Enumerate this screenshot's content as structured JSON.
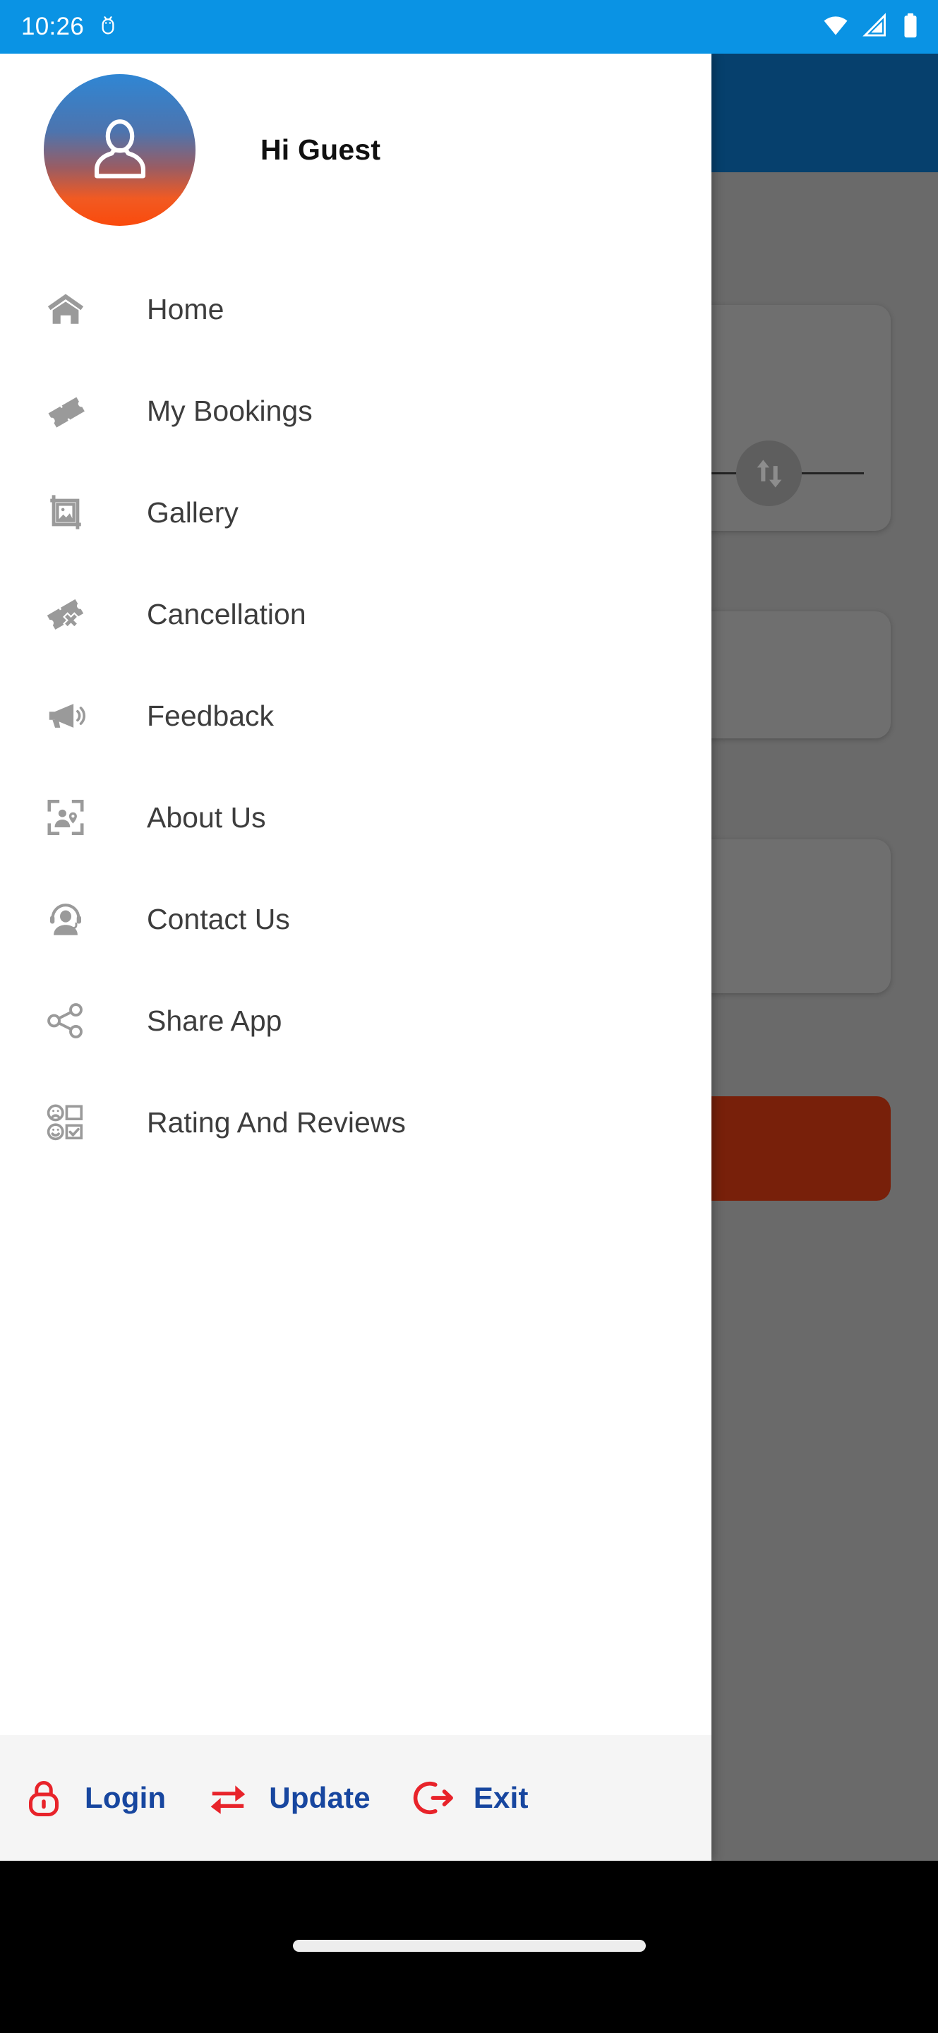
{
  "status_bar": {
    "time": "10:26",
    "icons": [
      "android-debug-icon",
      "wifi-icon",
      "cellular-signal-icon",
      "battery-icon"
    ],
    "background_color": "#0a93e4"
  },
  "background_app": {
    "appbar_color": "#06406d",
    "scrim_color": "#6a6a6a",
    "swap_button_icon": "swap-vertical-icon",
    "primary_button_color": "#78200a",
    "cards": [
      "search-card",
      "offer-card",
      "info-card"
    ]
  },
  "drawer": {
    "header": {
      "avatar_icon": "user-avatar-icon",
      "greeting": "Hi Guest",
      "avatar_gradient_from": "#2f86d4",
      "avatar_gradient_to": "#fa4a0c"
    },
    "items": [
      {
        "label": "Home",
        "icon": "home-icon"
      },
      {
        "label": "My Bookings",
        "icon": "ticket-icon"
      },
      {
        "label": "Gallery",
        "icon": "image-crop-icon"
      },
      {
        "label": "Cancellation",
        "icon": "ticket-cancel-icon"
      },
      {
        "label": "Feedback",
        "icon": "megaphone-icon"
      },
      {
        "label": "About Us",
        "icon": "person-location-frame-icon"
      },
      {
        "label": "Contact Us",
        "icon": "headset-support-icon"
      },
      {
        "label": "Share App",
        "icon": "share-nodes-icon"
      },
      {
        "label": "Rating And Reviews",
        "icon": "survey-emoji-icon"
      }
    ],
    "item_text_color": "#3d3d3d",
    "icon_color": "#9a9a9a",
    "actions": [
      {
        "label": "Login",
        "icon": "lock-icon"
      },
      {
        "label": "Update",
        "icon": "swap-horizontal-icon"
      },
      {
        "label": "Exit",
        "icon": "logout-icon"
      }
    ],
    "action_text_color": "#17469f",
    "action_icon_color": "#e8232a",
    "actions_background": "#f5f5f5"
  },
  "nav_bar": {
    "gesture_pill": "home-gesture-pill",
    "background_color": "#000000"
  }
}
